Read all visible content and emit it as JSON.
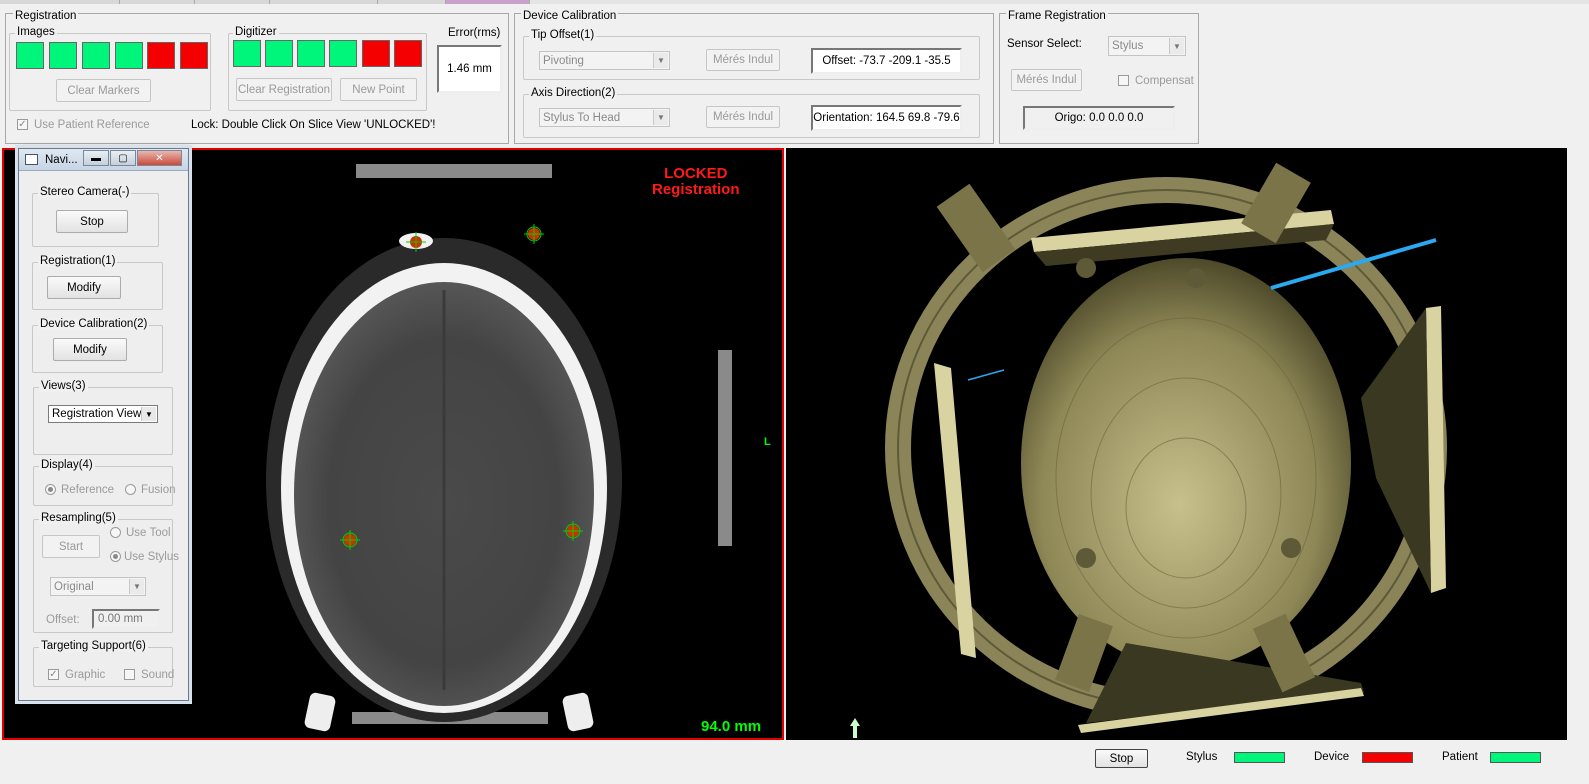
{
  "registration": {
    "legend": "Registration",
    "images": {
      "legend": "Images",
      "markers": [
        "green",
        "green",
        "green",
        "green",
        "red",
        "red"
      ],
      "clear_markers_label": "Clear Markers"
    },
    "digitizer": {
      "legend": "Digitizer",
      "markers": [
        "green",
        "green",
        "green",
        "green",
        "red",
        "red"
      ],
      "clear_registration_label": "Clear Registration",
      "new_point_label": "New Point"
    },
    "error": {
      "label": "Error(rms)",
      "value": "1.46 mm"
    },
    "use_patient_reference": {
      "label": "Use Patient Reference",
      "checked": true
    },
    "lock_text": "Lock: Double Click On Slice View 'UNLOCKED'!"
  },
  "device_calibration": {
    "legend": "Device Calibration",
    "tip_offset": {
      "legend": "Tip Offset(1)",
      "method": "Pivoting",
      "start_label": "Mérés Indul",
      "result": "Offset: -73.7 -209.1 -35.5"
    },
    "axis_direction": {
      "legend": "Axis Direction(2)",
      "method": "Stylus To Head",
      "start_label": "Mérés Indul",
      "result": "Orientation: 164.5 69.8 -79.6"
    }
  },
  "frame_registration": {
    "legend": "Frame Registration",
    "sensor_select_label": "Sensor Select:",
    "sensor_value": "Stylus",
    "start_label": "Mérés Indul",
    "compensate_label": "Compensat",
    "origo": "Origo: 0.0 0.0 0.0"
  },
  "slice_view": {
    "lock_status": "LOCKED",
    "lock_caption": "Registration",
    "orientation_marker": "L",
    "depth": "94.0 mm",
    "colors": {
      "border": "#e00000",
      "lock_text": "#ff1a1a",
      "depth_text": "#00ff00",
      "fiducial": "#00d000"
    }
  },
  "navigation_window": {
    "title": "Navi...",
    "stereo_camera": {
      "legend": "Stereo Camera(-)",
      "button": "Stop"
    },
    "registration": {
      "legend": "Registration(1)",
      "button": "Modify"
    },
    "device_calibration": {
      "legend": "Device Calibration(2)",
      "button": "Modify"
    },
    "views": {
      "legend": "Views(3)",
      "selected": "Registration View"
    },
    "display": {
      "legend": "Display(4)",
      "reference": "Reference",
      "fusion": "Fusion"
    },
    "resampling": {
      "legend": "Resampling(5)",
      "start": "Start",
      "use_tool": "Use Tool",
      "use_stylus": "Use Stylus",
      "mode": "Original",
      "offset_label": "Offset:",
      "offset_value": "0.00 mm"
    },
    "targeting": {
      "legend": "Targeting Support(6)",
      "graphic": "Graphic",
      "sound": "Sound"
    }
  },
  "status_bar": {
    "stop_label": "Stop",
    "indicators": [
      {
        "label": "Stylus",
        "color": "#00f57b"
      },
      {
        "label": "Device",
        "color": "#f50000"
      },
      {
        "label": "Patient",
        "color": "#00f57b"
      }
    ]
  }
}
